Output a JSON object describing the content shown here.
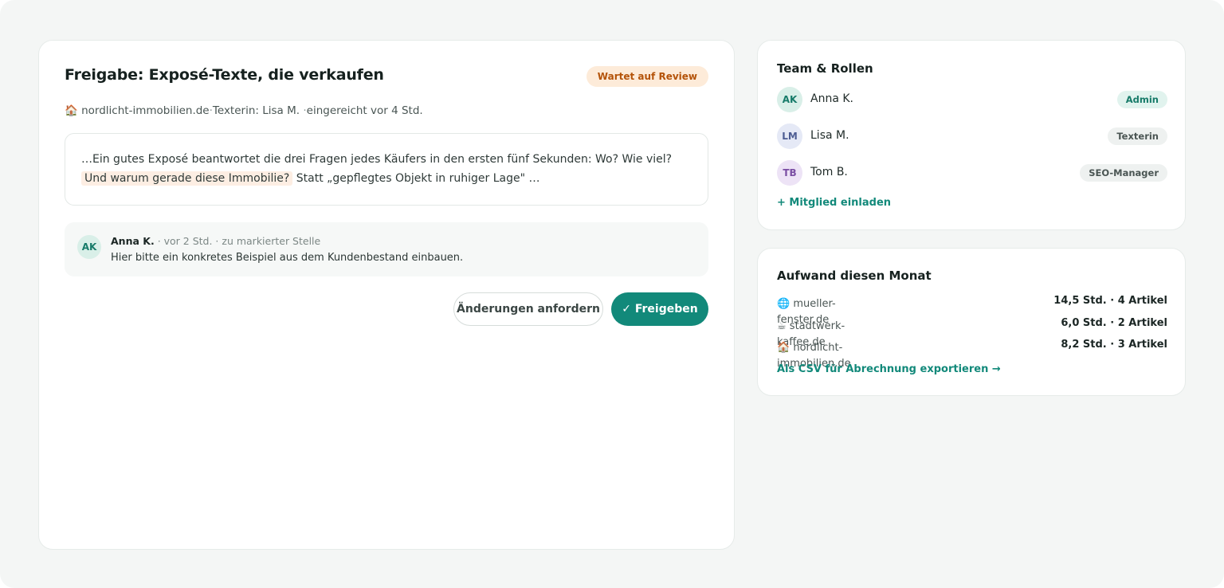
{
  "review": {
    "title": "Freigabe: Exposé-Texte, die verkaufen",
    "status": "Wartet auf Review",
    "site_icon": "🏠",
    "site": "nordlicht-immobilien.de",
    "writer": "Texterin: Lisa M.",
    "submitted": "eingereicht vor 4 Std.",
    "separator": "·",
    "excerpt_before": "…Ein gutes Exposé beantwortet die drei Fragen jedes Käufers in den ersten fünf Sekunden: Wo? Wie viel?",
    "excerpt_highlight": "Und warum gerade diese Immobilie?",
    "excerpt_after": "Statt „gepflegtes Objekt in ruhiger Lage\" …",
    "comment": {
      "initials": "AK",
      "author": "Anna K.",
      "meta": "· vor 2 Std. · zu markierter Stelle",
      "text": "Hier bitte ein konkretes Beispiel aus dem Kundenbestand einbauen."
    },
    "request_changes_label": "Änderungen anfordern",
    "approve_label": "✓ Freigeben"
  },
  "team": {
    "title": "Team & Rollen",
    "members": [
      {
        "initials": "AK",
        "name": "Anna K.",
        "role": "Admin"
      },
      {
        "initials": "LM",
        "name": "Lisa M.",
        "role": "Texterin"
      },
      {
        "initials": "TB",
        "name": "Tom B.",
        "role": "SEO-Manager"
      }
    ],
    "invite_label": "+ Mitglied einladen"
  },
  "effort": {
    "title": "Aufwand diesen Monat",
    "rows": [
      {
        "icon": "🌐",
        "site": "mueller-fenster.de",
        "value": "14,5 Std. · 4 Artikel"
      },
      {
        "icon": "☕",
        "site": "stadtwerk-kaffee.de",
        "value": "6,0 Std. · 2 Artikel"
      },
      {
        "icon": "🏠",
        "site": "nordlicht-immobilien.de",
        "value": "8,2 Std. · 3 Artikel"
      }
    ],
    "export_label": "Als CSV für Abrechnung exportieren →"
  },
  "colors": {
    "accent": "#12897a",
    "status_bg": "#fdebd9",
    "status_text": "#b45309",
    "admin_bg": "#e1f3ee",
    "admin_text": "#177b69",
    "texterin_bg": "#eef1f0",
    "seo_bg": "#eef1f0"
  }
}
